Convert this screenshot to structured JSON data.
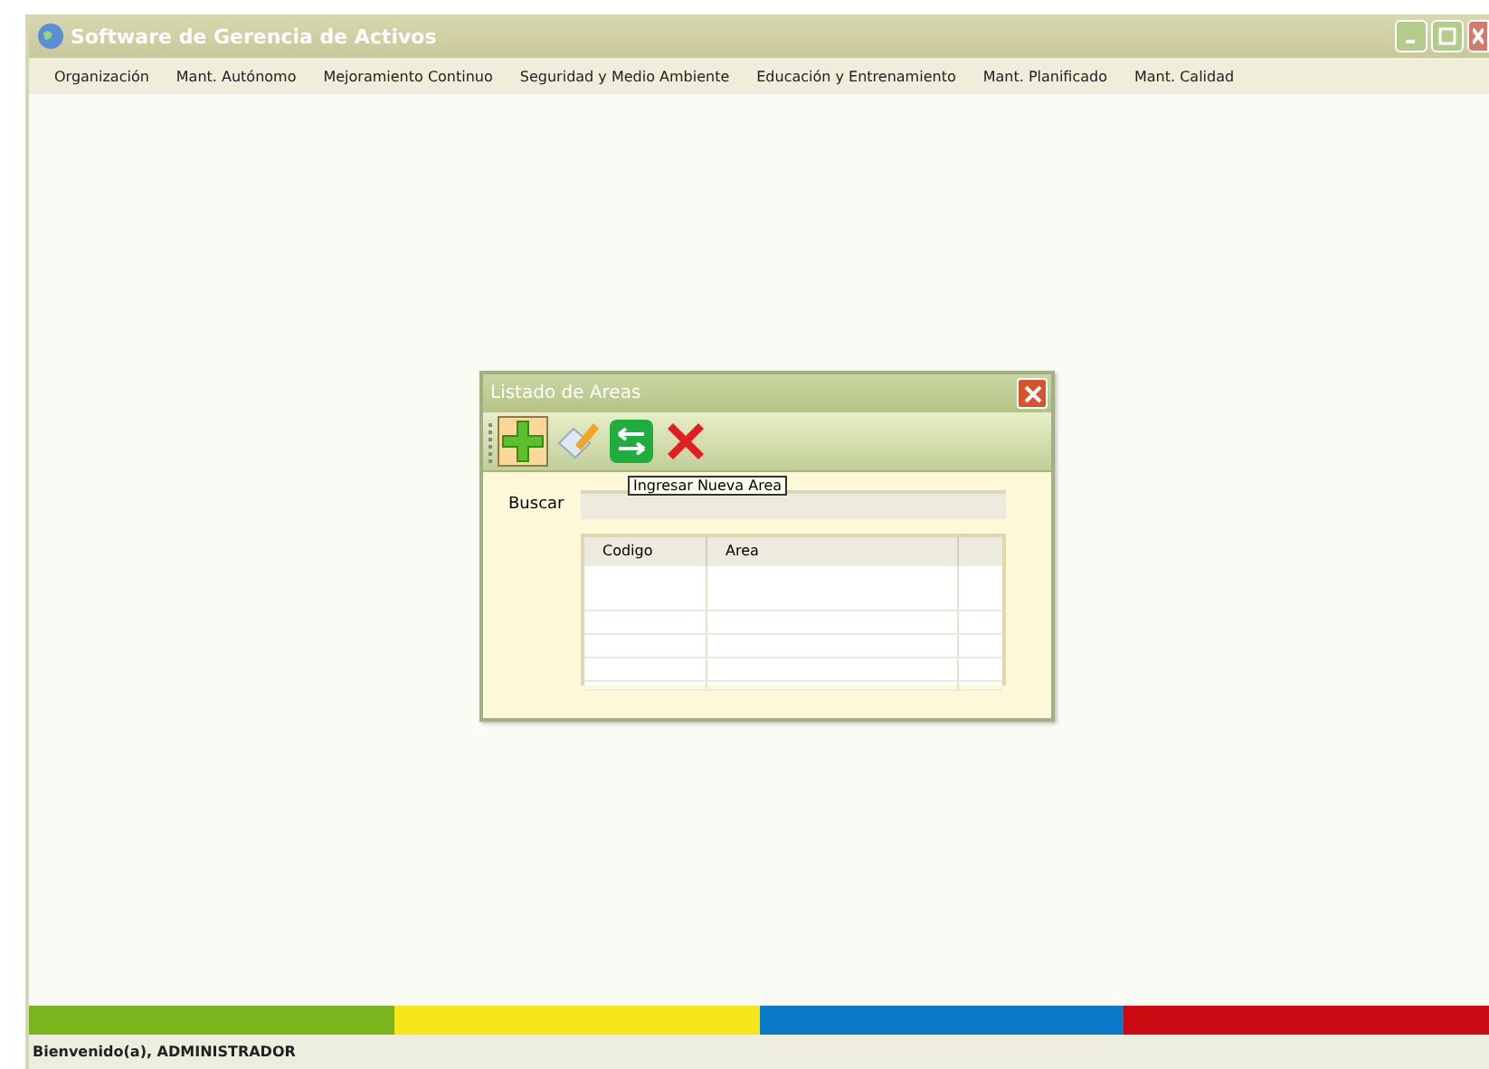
{
  "window": {
    "title": "Software de Gerencia de Activos"
  },
  "menu": [
    "Organización",
    "Mant. Autónomo",
    "Mejoramiento Continuo",
    "Seguridad y Medio Ambiente",
    "Educación y Entrenamiento",
    "Mant. Planificado",
    "Mant. Calidad"
  ],
  "dialog": {
    "title": "Listado de Areas",
    "toolbar": [
      {
        "kind": "add",
        "highlighted": true
      },
      {
        "kind": "edit",
        "highlighted": false
      },
      {
        "kind": "transfer",
        "highlighted": false
      },
      {
        "kind": "delete",
        "highlighted": false
      }
    ],
    "tooltip": "Ingresar Nueva Area",
    "search": {
      "label": "Buscar"
    },
    "table": {
      "columns": [
        "Codigo",
        "Area"
      ]
    }
  },
  "color_bar": [
    {
      "color": "#7ab51d"
    },
    {
      "color": "#f7e61c"
    },
    {
      "color": "#0b7ac8"
    },
    {
      "color": "#cc0a12"
    }
  ],
  "status_bar": "Bienvenido(a), ADMINISTRADOR"
}
